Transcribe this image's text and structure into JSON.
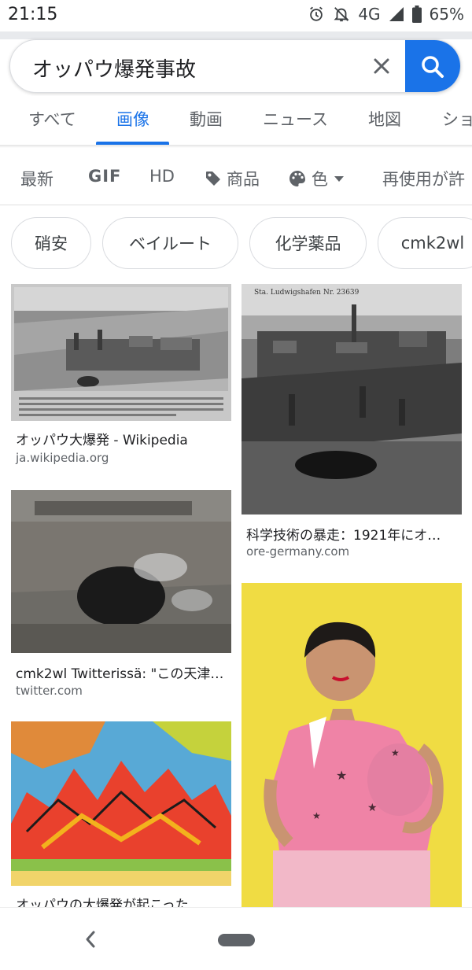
{
  "status_bar": {
    "time": "21:15",
    "network": "4G",
    "battery": "65%",
    "icons": [
      "alarm-icon",
      "notifications-off-icon",
      "signal-icon",
      "battery-icon"
    ]
  },
  "search": {
    "query": "オッパウ爆発事故",
    "clear_icon": "close-icon",
    "search_icon": "search-icon",
    "accent": "#1a73e8"
  },
  "tabs": [
    {
      "label": "すべて",
      "active": false
    },
    {
      "label": "画像",
      "active": true
    },
    {
      "label": "動画",
      "active": false
    },
    {
      "label": "ニュース",
      "active": false
    },
    {
      "label": "地図",
      "active": false
    },
    {
      "label": "ショ",
      "active": false
    }
  ],
  "filters": {
    "latest": "最新",
    "gif": "GIF",
    "hd": "HD",
    "products": "商品",
    "color": "色",
    "reuse": "再使用が許"
  },
  "chips": [
    "硝安",
    "ベイルート",
    "化学薬品",
    "cmk2wl"
  ],
  "results": [
    {
      "title": "オッパウ大爆発 - Wikipedia",
      "source": "ja.wikipedia.org"
    },
    {
      "title": "科学技術の暴走：1921年にオ…",
      "source": "ore-germany.com",
      "caption_in_image": "Sta. Ludwigshafen Nr. 23639"
    },
    {
      "title": "cmk2wl Twitterissä: \"この天津…",
      "source": "twitter.com"
    },
    {
      "title": "オッパウの大爆発が起こった…",
      "source": ""
    }
  ],
  "nav": {
    "back_icon": "back-chevron-icon",
    "home_icon": "home-pill-icon"
  }
}
